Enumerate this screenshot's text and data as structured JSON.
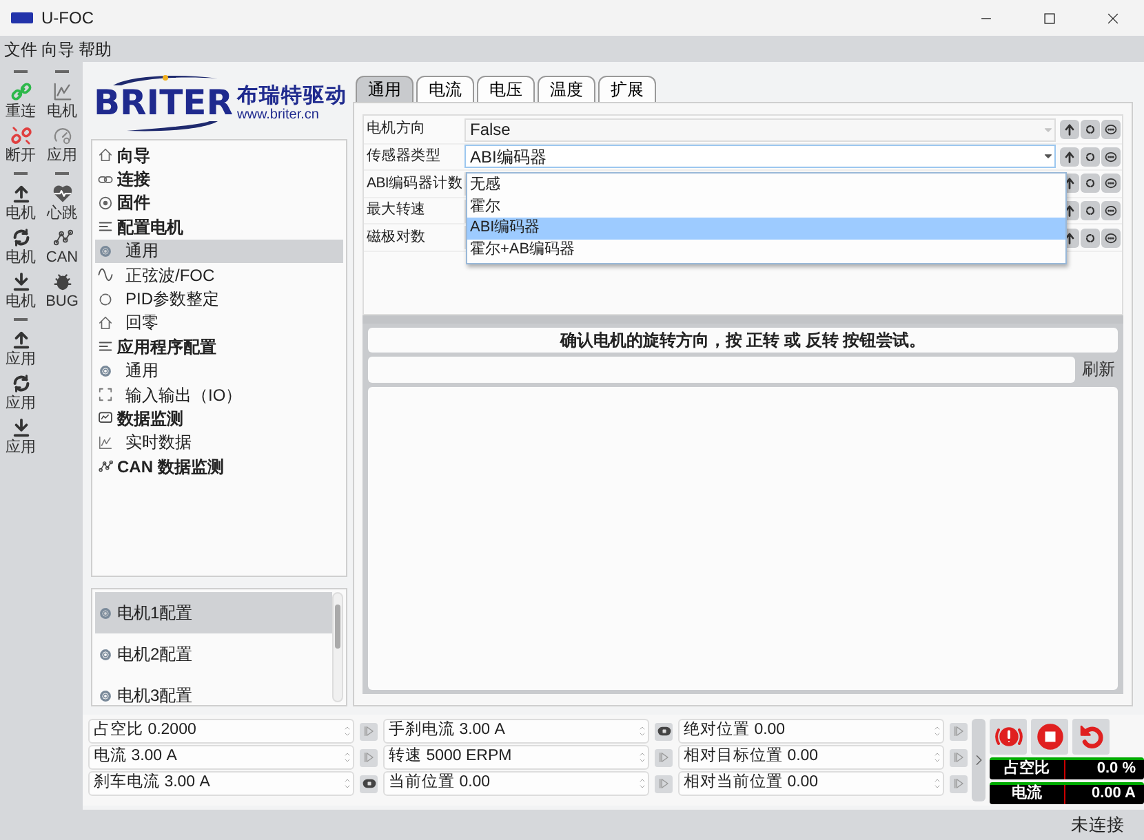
{
  "window": {
    "title": "U-FOC"
  },
  "menu": [
    "文件",
    "向导",
    "帮助"
  ],
  "toolbar": {
    "columns": [
      [
        {
          "kind": "separator"
        },
        {
          "kind": "connect",
          "label": "重连"
        },
        {
          "kind": "disconnect",
          "label": "断开"
        },
        {
          "kind": "separator"
        },
        {
          "kind": "upload",
          "label": "电机"
        },
        {
          "kind": "refresh",
          "label": "电机"
        },
        {
          "kind": "download",
          "label": "电机"
        },
        {
          "kind": "separator"
        },
        {
          "kind": "upload",
          "label": "应用"
        },
        {
          "kind": "refresh",
          "label": "应用"
        },
        {
          "kind": "download",
          "label": "应用"
        }
      ],
      [
        {
          "kind": "separator"
        },
        {
          "kind": "chart",
          "label": "电机"
        },
        {
          "kind": "gauge",
          "label": "应用"
        },
        {
          "kind": "separator"
        },
        {
          "kind": "heart",
          "label": "心跳"
        },
        {
          "kind": "wave",
          "label": "CAN"
        },
        {
          "kind": "bug",
          "label": "BUG"
        }
      ]
    ]
  },
  "logo": {
    "brand": "BRITER",
    "name": "布瑞特驱动",
    "url": "www.briter.cn"
  },
  "tree": [
    {
      "kind": "home",
      "label": "向导",
      "selected": false
    },
    {
      "kind": "link",
      "label": "连接",
      "selected": false
    },
    {
      "kind": "chip",
      "label": "固件",
      "selected": false
    },
    {
      "kind": "sliders",
      "label": "配置电机",
      "selected": false,
      "children": [
        {
          "kind": "gear",
          "label": "通用",
          "selected": true
        },
        {
          "kind": "sine",
          "label": "正弦波/FOC",
          "selected": false
        },
        {
          "kind": "circle",
          "label": "PID参数整定",
          "selected": false
        },
        {
          "kind": "home",
          "label": "回零",
          "selected": false
        }
      ]
    },
    {
      "kind": "sliders",
      "label": "应用程序配置",
      "selected": false,
      "children": [
        {
          "kind": "gear",
          "label": "通用",
          "selected": false
        },
        {
          "kind": "expand",
          "label": "输入输出（IO）",
          "selected": false
        }
      ]
    },
    {
      "kind": "monitor",
      "label": "数据监测",
      "selected": false,
      "children": [
        {
          "kind": "chart",
          "label": "实时数据",
          "selected": false
        }
      ]
    },
    {
      "kind": "wave",
      "label": "CAN 数据监测",
      "selected": false
    }
  ],
  "motors": [
    {
      "label": "电机1配置",
      "selected": true
    },
    {
      "label": "电机2配置",
      "selected": false
    },
    {
      "label": "电机3配置",
      "selected": false
    }
  ],
  "tabs": [
    {
      "label": "通用",
      "selected": true
    },
    {
      "label": "电流",
      "selected": false
    },
    {
      "label": "电压",
      "selected": false
    },
    {
      "label": "温度",
      "selected": false
    },
    {
      "label": "扩展",
      "selected": false
    }
  ],
  "params": [
    {
      "label": "电机方向",
      "value": "False"
    },
    {
      "label": "传感器类型",
      "value": "ABI编码器",
      "expanded": true
    },
    {
      "label": "ABI编码器计数"
    },
    {
      "label": "最大转速"
    },
    {
      "label": "磁极对数"
    }
  ],
  "dropdown": {
    "options": [
      {
        "label": "无感",
        "selected": false
      },
      {
        "label": "霍尔",
        "selected": false
      },
      {
        "label": "ABI编码器",
        "selected": true
      },
      {
        "label": "霍尔+AB编码器",
        "selected": false
      }
    ]
  },
  "hint": "确认电机的旋转方向，按 正转 或 反转 按钮尝试。",
  "refresh_label": "刷新",
  "controls": [
    [
      {
        "text": "占空比 0.2000",
        "kind": "play"
      },
      {
        "text": "手刹电流 3.00 A",
        "kind": "hold"
      },
      {
        "text": "绝对位置 0.00",
        "kind": "play"
      }
    ],
    [
      {
        "text": "电流 3.00 A",
        "kind": "play"
      },
      {
        "text": "转速 5000 ERPM",
        "kind": "play"
      },
      {
        "text": "相对目标位置 0.00",
        "kind": "play"
      }
    ],
    [
      {
        "text": "刹车电流 3.00 A",
        "kind": "hold"
      },
      {
        "text": "当前位置 0.00",
        "kind": "play"
      },
      {
        "text": "相对当前位置 0.00",
        "kind": "play"
      }
    ]
  ],
  "actions": [
    {
      "kind": "alarm"
    },
    {
      "kind": "stop"
    },
    {
      "kind": "reset"
    }
  ],
  "meters": [
    {
      "label": "占空比",
      "value": "0.0 %"
    },
    {
      "label": "电流",
      "value": "0.00 A"
    }
  ],
  "status_bar": "未连接"
}
